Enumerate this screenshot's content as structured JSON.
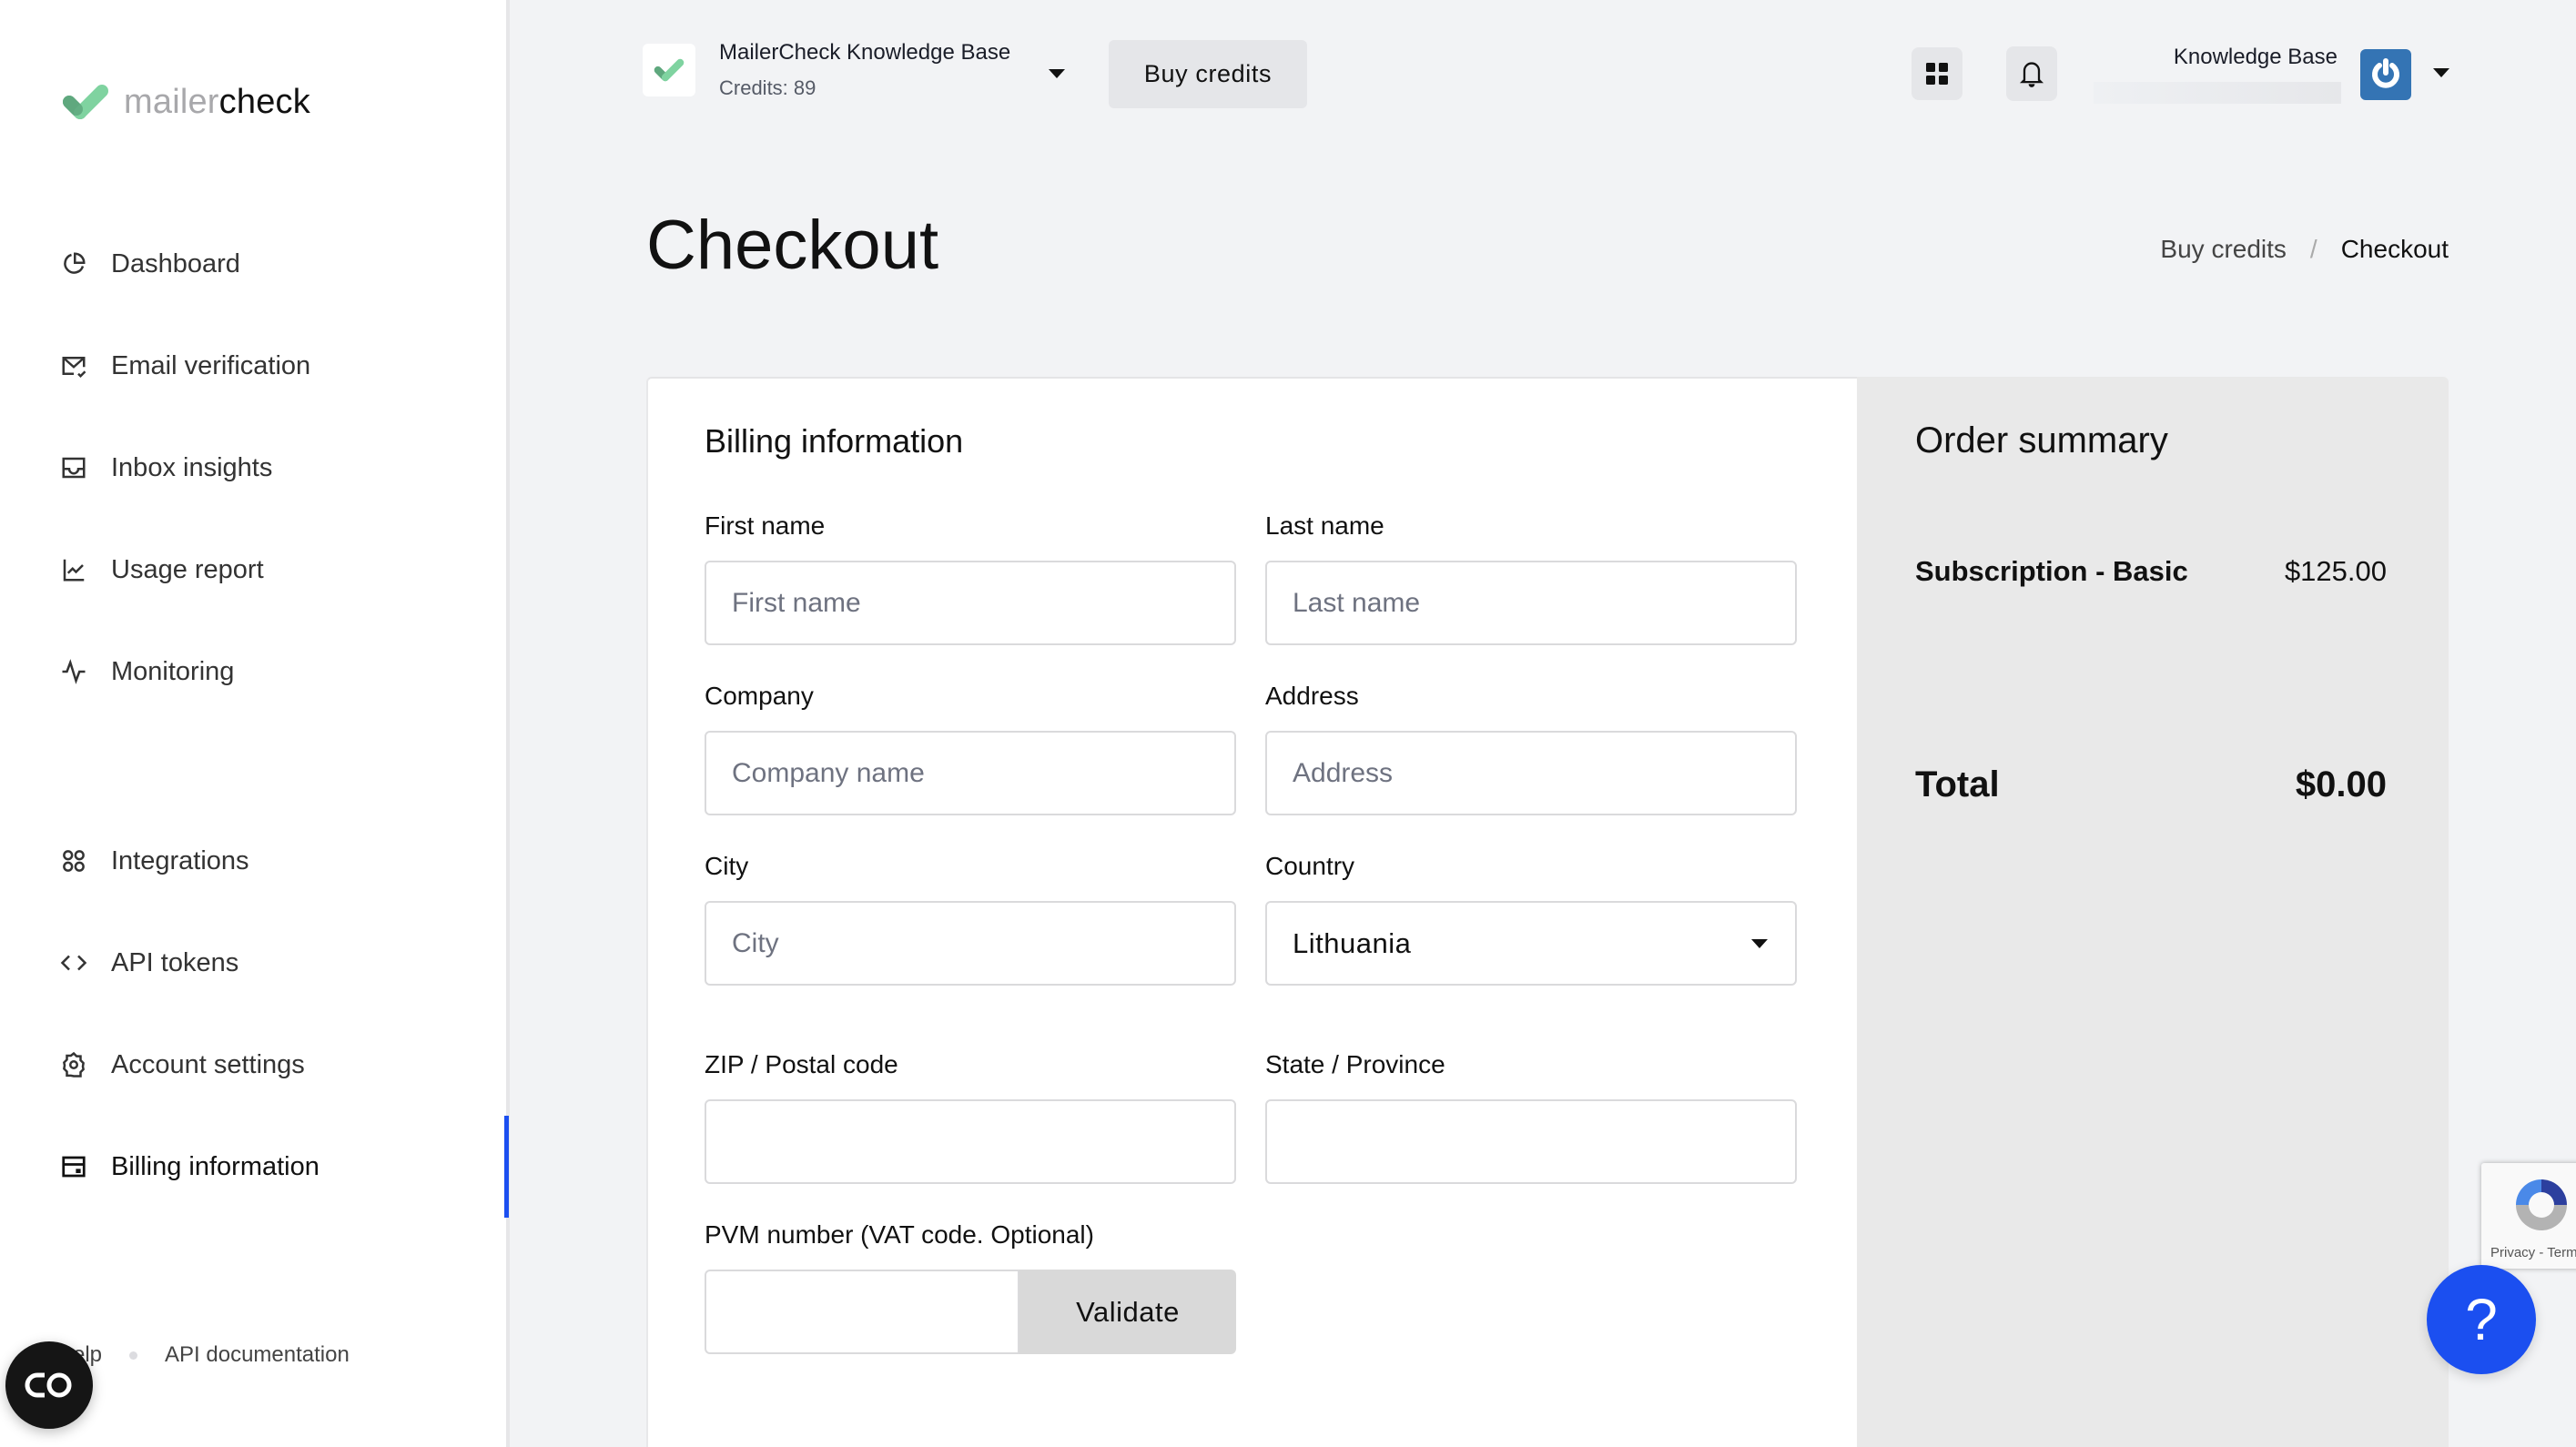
{
  "brand": {
    "name_light": "mailer",
    "name_dark": "check",
    "accent": "#1b4ff0",
    "logo_green_light": "#7fd3a0",
    "logo_green_dark": "#5fa87e"
  },
  "sidebar": {
    "items": [
      {
        "label": "Dashboard",
        "icon": "pie-chart-icon"
      },
      {
        "label": "Email verification",
        "icon": "mail-check-icon"
      },
      {
        "label": "Inbox insights",
        "icon": "inbox-icon"
      },
      {
        "label": "Usage report",
        "icon": "line-chart-icon"
      },
      {
        "label": "Monitoring",
        "icon": "pulse-icon"
      },
      {
        "label": "Integrations",
        "icon": "command-icon"
      },
      {
        "label": "API tokens",
        "icon": "code-icon"
      },
      {
        "label": "Account settings",
        "icon": "gear-icon"
      },
      {
        "label": "Billing information",
        "icon": "credit-card-icon",
        "active": true
      }
    ],
    "footer": {
      "help_label": "elp",
      "api_docs_label": "API documentation"
    }
  },
  "topbar": {
    "org_name": "MailerCheck Knowledge Base",
    "credits": "Credits: 89",
    "buy_credits_label": "Buy credits",
    "user_name": "Knowledge Base"
  },
  "page": {
    "title": "Checkout",
    "breadcrumb": [
      {
        "label": "Buy credits"
      },
      {
        "label": "Checkout"
      }
    ],
    "breadcrumb_separator": "/"
  },
  "billing_form": {
    "title": "Billing information",
    "fields": {
      "first_name": {
        "label": "First name",
        "placeholder": "First name",
        "value": ""
      },
      "last_name": {
        "label": "Last name",
        "placeholder": "Last name",
        "value": ""
      },
      "company": {
        "label": "Company",
        "placeholder": "Company name",
        "value": ""
      },
      "address": {
        "label": "Address",
        "placeholder": "Address",
        "value": ""
      },
      "city": {
        "label": "City",
        "placeholder": "City",
        "value": ""
      },
      "country": {
        "label": "Country",
        "value": "Lithuania"
      },
      "zip": {
        "label": "ZIP / Postal code",
        "placeholder": "",
        "value": ""
      },
      "state": {
        "label": "State / Province",
        "placeholder": "",
        "value": ""
      },
      "vat": {
        "label": "PVM number (VAT code. Optional)",
        "placeholder": "",
        "value": ""
      }
    },
    "validate_label": "Validate"
  },
  "order_summary": {
    "title": "Order summary",
    "items": [
      {
        "name": "Subscription - Basic",
        "price": "$125.00"
      }
    ],
    "total_label": "Total",
    "total_value": "$0.00"
  },
  "widgets": {
    "recaptcha_text": "Privacy - Terms",
    "help_label": "?"
  }
}
